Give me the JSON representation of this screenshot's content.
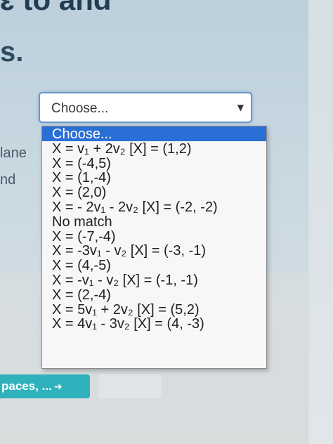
{
  "heading_fragment": "ɛ to and",
  "heading_suffix": "s.",
  "side_labels": [
    "lane",
    "nd"
  ],
  "select": {
    "value": "Choose...",
    "arrow_icon": "triangle-down-icon"
  },
  "dropdown": {
    "options": [
      "Choose...",
      "X = v₁ + 2v₂ [X] = (1,2)",
      "X = (-4,5)",
      "X = (1,-4)",
      "X = (2,0)",
      "X = - 2v₁ - 2v₂ [X] = (-2, -2)",
      "No match",
      "X = (-7,-4)",
      "X = -3v₁ - v₂ [X] = (-3, -1)",
      "X = (4,-5)",
      "X = -v₁ - v₂ [X] = (-1, -1)",
      "X = (2,-4)",
      "X = 5v₁ + 2v₂ [X] = (5,2)",
      "X = 4v₁ - 3v₂ [X] = (4, -3)"
    ],
    "highlighted_index": 0,
    "highlight_color": "#2a6fd6"
  },
  "continue_button": {
    "label": "paces, ...",
    "icon": "arrow-right-icon",
    "color": "#2fb2bb"
  }
}
